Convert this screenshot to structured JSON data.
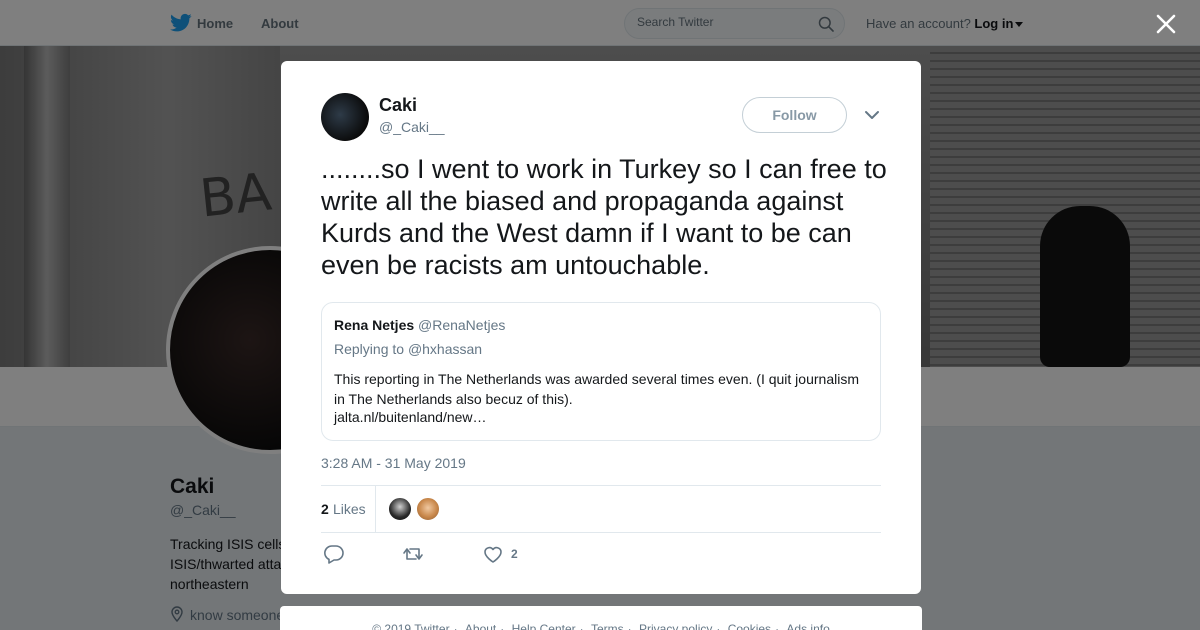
{
  "nav": {
    "home_label": "Home",
    "about_label": "About",
    "search_placeholder": "Search Twitter",
    "account_prompt": "Have an account?",
    "login_label": "Log in"
  },
  "profile": {
    "name": "Caki",
    "handle": "@_Caki__",
    "bio": "Tracking ISIS cells ISIS/thwarted atta and northeastern",
    "location": "know someone"
  },
  "banner": {
    "graffiti": "BA"
  },
  "tweet": {
    "author_name": "Caki",
    "author_handle": "@_Caki__",
    "follow_label": "Follow",
    "text": "........so I went to work in Turkey so I can free to write all the biased and propaganda against Kurds and the West damn if I want to be can even be racists am untouchable.",
    "quoted": {
      "name": "Rena Netjes",
      "handle": "@RenaNetjes",
      "replying_prefix": "Replying to",
      "replying_to": "@hxhassan",
      "text": "This reporting in The Netherlands was awarded several times even. (I quit journalism in The Netherlands also becuz of this).",
      "link": "jalta.nl/buitenland/new…"
    },
    "timestamp": "3:28 AM - 31 May 2019",
    "likes_count": "2",
    "likes_label": "Likes",
    "like_action_count": "2"
  },
  "footer": {
    "links": [
      "© 2019 Twitter",
      "About",
      "Help Center",
      "Terms",
      "Privacy policy",
      "Cookies",
      "Ads info"
    ]
  },
  "colors": {
    "brand": "#1da1f2",
    "text": "#14171a",
    "muted": "#657786",
    "border": "#e1e8ed"
  },
  "icons": [
    "twitter-bird-icon",
    "search-icon",
    "caret-down-icon",
    "close-icon",
    "chevron-down-icon",
    "reply-icon",
    "retweet-icon",
    "heart-icon",
    "location-pin-icon"
  ]
}
